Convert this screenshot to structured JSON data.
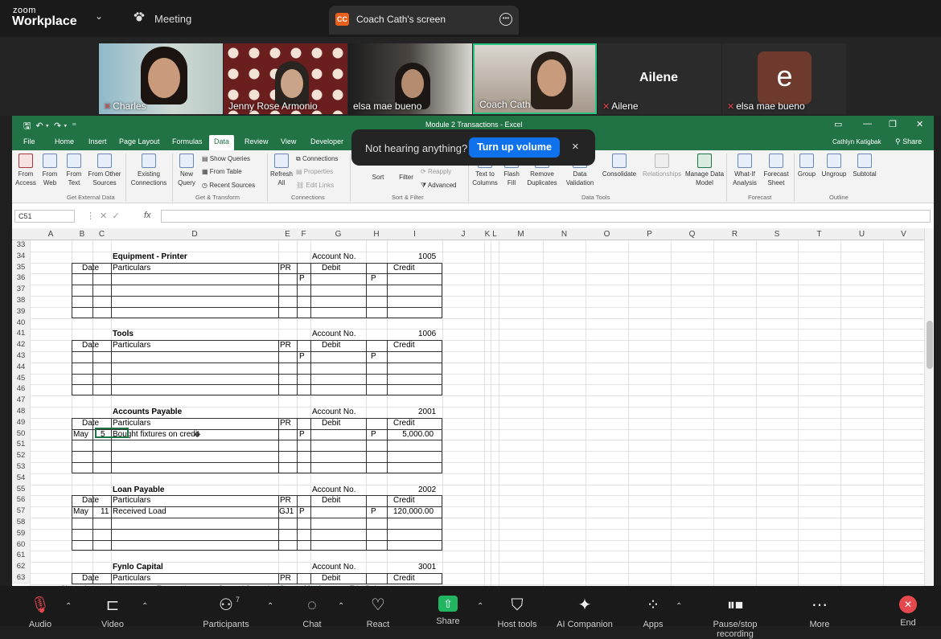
{
  "zoom": {
    "logo_top": "zoom",
    "logo_bottom": "Workplace",
    "meeting_label": "Meeting",
    "screen_tab": {
      "badge": "CC",
      "label": "Coach Cath's screen"
    }
  },
  "participants": [
    {
      "name": "Charles",
      "muted": true
    },
    {
      "name": "Jenny Rose Armonio",
      "muted": false
    },
    {
      "name": "elsa mae bueno",
      "muted": false
    },
    {
      "name": "Coach Cath",
      "muted": false,
      "active_speaker": true
    },
    {
      "name": "Ailene",
      "muted": true,
      "display": "Ailene"
    },
    {
      "name": "elsa mae bueno",
      "muted": true,
      "avatar_letter": "e"
    }
  ],
  "toast": {
    "text": "Not hearing anything?",
    "button": "Turn up volume",
    "close": "×"
  },
  "excel": {
    "title": "Module 2 Transactions - Excel",
    "user": "Cathlyn Katigbak",
    "share": "Share",
    "tabs": [
      "File",
      "Home",
      "Insert",
      "Page Layout",
      "Formulas",
      "Data",
      "Review",
      "View",
      "Developer"
    ],
    "active_tab": "Data",
    "ribbon": {
      "buttons": [
        {
          "label": "From Access"
        },
        {
          "label": "From Web"
        },
        {
          "label": "From Text"
        },
        {
          "label": "From Other Sources"
        },
        {
          "label": "Existing Connections"
        },
        {
          "label": "New Query"
        },
        {
          "label": "Refresh All"
        },
        {
          "label": "Sort"
        },
        {
          "label": "Filter"
        },
        {
          "label": "Text to Columns"
        },
        {
          "label": "Flash Fill"
        },
        {
          "label": "Remove Duplicates"
        },
        {
          "label": "Data Validation"
        },
        {
          "label": "Consolidate"
        },
        {
          "label": "Relationships"
        },
        {
          "label": "Manage Data Model"
        },
        {
          "label": "What-If Analysis"
        },
        {
          "label": "Forecast Sheet"
        },
        {
          "label": "Group"
        },
        {
          "label": "Ungroup"
        },
        {
          "label": "Subtotal"
        }
      ],
      "small": [
        "Show Queries",
        "From Table",
        "Recent Sources",
        "Connections",
        "Properties",
        "Edit Links",
        "Reapply",
        "Advanced"
      ],
      "groups": [
        "Get External Data",
        "Get & Transform",
        "Connections",
        "Sort & Filter",
        "Data Tools",
        "Forecast",
        "Outline"
      ]
    },
    "name_box": "C51",
    "fx": "fx",
    "columns": [
      "A",
      "B",
      "C",
      "D",
      "E",
      "F",
      "G",
      "H",
      "I",
      "J",
      "K",
      "L",
      "M",
      "N",
      "O",
      "P",
      "Q",
      "R",
      "S",
      "T",
      "U",
      "V"
    ],
    "rows": [
      "33",
      "34",
      "35",
      "36",
      "37",
      "38",
      "39",
      "40",
      "41",
      "42",
      "43",
      "44",
      "45",
      "46",
      "47",
      "48",
      "49",
      "50",
      "51",
      "52",
      "53",
      "54",
      "55",
      "56",
      "57",
      "58",
      "59",
      "60",
      "61",
      "62",
      "63"
    ],
    "accounts": [
      {
        "title": "Equipment - Printer",
        "account_no_label": "Account No.",
        "account_no": "1005",
        "entries": []
      },
      {
        "title": "Tools",
        "account_no_label": "Account No.",
        "account_no": "1006",
        "entries": []
      },
      {
        "title": "Accounts Payable",
        "account_no_label": "Account No.",
        "account_no": "2001",
        "entries": [
          {
            "month": "May",
            "day": "5",
            "particulars": "Bought fixtures on credit",
            "pr": "",
            "credit": "5,000.00"
          }
        ]
      },
      {
        "title": "Loan Payable",
        "account_no_label": "Account No.",
        "account_no": "2002",
        "entries": [
          {
            "month": "May",
            "day": "11",
            "particulars": "Received Load",
            "pr": "GJ1",
            "credit": "120,000.00"
          }
        ]
      },
      {
        "title": "Fynlo Capital",
        "account_no_label": "Account No.",
        "account_no": "3001",
        "entries": []
      }
    ],
    "header": {
      "date": "Date",
      "particulars": "Particulars",
      "pr": "PR",
      "debit": "Debit",
      "credit": "Credit",
      "p": "P"
    },
    "sheet_tabs": [
      "Chart of accounts",
      "Transactions",
      "General Journal",
      "General Ledger",
      "Trial Balance"
    ]
  },
  "toolbar": {
    "items": [
      {
        "label": "Audio",
        "icon": "mic-muted-icon"
      },
      {
        "label": "Video",
        "icon": "video-icon"
      },
      {
        "label": "Participants",
        "icon": "participants-icon",
        "count": "7"
      },
      {
        "label": "Chat",
        "icon": "chat-icon"
      },
      {
        "label": "React",
        "icon": "heart-icon"
      },
      {
        "label": "Share",
        "icon": "share-icon"
      },
      {
        "label": "Host tools",
        "icon": "shield-icon"
      },
      {
        "label": "AI Companion",
        "icon": "sparkle-icon"
      },
      {
        "label": "Apps",
        "icon": "apps-icon"
      },
      {
        "label": "Pause/stop recording",
        "icon": "recording-icon"
      },
      {
        "label": "More",
        "icon": "more-icon"
      },
      {
        "label": "End",
        "icon": "end-icon"
      }
    ]
  },
  "colors": {
    "excel_green": "#217346",
    "zoom_blue": "#0e72ed",
    "active_speaker": "#27c57f",
    "share_green": "#21b562",
    "end_red": "#e5484d"
  }
}
